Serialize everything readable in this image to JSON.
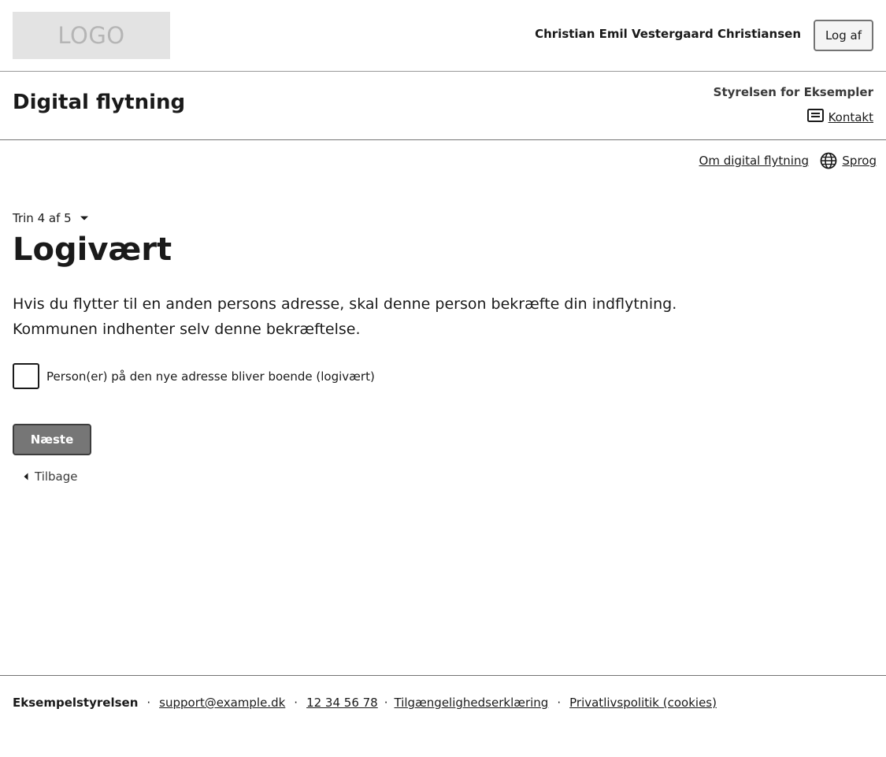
{
  "topbar": {
    "logo_text": "LOGO",
    "user_name": "Christian Emil Vestergaard Christiansen",
    "logout_label": "Log af"
  },
  "header": {
    "service_title": "Digital flytning",
    "authority": "Styrelsen for Eksempler",
    "contact_label": "Kontakt",
    "contact_icon": "message-icon"
  },
  "subnav": {
    "about_label": "Om digital flytning",
    "language_label": "Sprog",
    "language_icon": "globe-icon"
  },
  "main": {
    "step_label": "Trin 4 af 5",
    "title": "Logivært",
    "intro_line1": "Hvis du flytter til en anden persons adresse, skal denne person bekræfte din indflytning.",
    "intro_line2": "Kommunen indhenter selv denne bekræftelse.",
    "checkbox_label": "Person(er) på den nye adresse bliver boende (logivært)",
    "checkbox_checked": false,
    "next_label": "Næste",
    "back_label": "Tilbage"
  },
  "footer": {
    "org": "Eksempelstyrelsen",
    "separator": "·",
    "email": "support@example.dk",
    "phone": "12 34 56 78",
    "accessibility": "Tilgængelighedserklæring",
    "privacy": "Privatlivspolitik (cookies)"
  },
  "colors": {
    "primary_button": "#767676",
    "border": "#747474",
    "logo_bg": "#e3e3e3",
    "text": "#1a1a1a"
  }
}
